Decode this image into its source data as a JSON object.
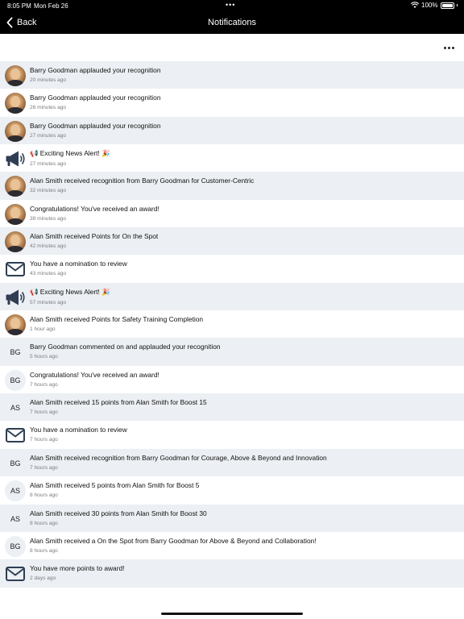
{
  "status_bar": {
    "time": "8:05 PM",
    "date": "Mon Feb 26",
    "battery": "100%"
  },
  "nav": {
    "back_label": "Back",
    "title": "Notifications"
  },
  "notifications": [
    {
      "avatar": "photo",
      "title": "Barry Goodman applauded your recognition",
      "time": "20 minutes ago"
    },
    {
      "avatar": "photo",
      "title": "Barry Goodman applauded your recognition",
      "time": "26 minutes ago"
    },
    {
      "avatar": "photo",
      "title": "Barry Goodman applauded your recognition",
      "time": "27 minutes ago"
    },
    {
      "avatar": "megaphone-icon",
      "title": "📢 Exciting News Alert! 🎉",
      "time": "27 minutes ago"
    },
    {
      "avatar": "photo",
      "title": "Alan Smith received recognition from Barry Goodman for Customer-Centric",
      "time": "32 minutes ago"
    },
    {
      "avatar": "photo",
      "title": "Congratulations! You've received an award!",
      "time": "39 minutes ago"
    },
    {
      "avatar": "photo",
      "title": "Alan Smith received Points for On the Spot",
      "time": "42 minutes ago"
    },
    {
      "avatar": "envelope-icon",
      "title": "You have a nomination to review",
      "time": "43 minutes ago"
    },
    {
      "avatar": "megaphone-icon",
      "title": "📢 Exciting News Alert! 🎉",
      "time": "57 minutes ago"
    },
    {
      "avatar": "photo",
      "title": "Alan Smith received Points for Safety Training Completion",
      "time": "1 hour ago"
    },
    {
      "avatar": "initials",
      "initials": "BG",
      "title": "Barry Goodman commented on and applauded your recognition",
      "time": "5 hours ago"
    },
    {
      "avatar": "initials",
      "initials": "BG",
      "title": "Congratulations! You've received an award!",
      "time": "7 hours ago"
    },
    {
      "avatar": "initials",
      "initials": "AS",
      "title": "Alan Smith received 15 points from Alan Smith for Boost 15",
      "time": "7 hours ago"
    },
    {
      "avatar": "envelope-icon",
      "title": "You have a nomination to review",
      "time": "7 hours ago"
    },
    {
      "avatar": "initials",
      "initials": "BG",
      "title": "Alan Smith received recognition from Barry Goodman for Courage, Above & Beyond and Innovation",
      "time": "7 hours ago"
    },
    {
      "avatar": "initials",
      "initials": "AS",
      "title": "Alan Smith received 5 points from Alan Smith for Boost 5",
      "time": "8 hours ago"
    },
    {
      "avatar": "initials",
      "initials": "AS",
      "title": "Alan Smith received 30 points from Alan Smith for Boost 30",
      "time": "8 hours ago"
    },
    {
      "avatar": "initials",
      "initials": "BG",
      "title": "Alan Smith received a On the Spot from Barry Goodman for Above & Beyond and Collaboration!",
      "time": "8 hours ago"
    },
    {
      "avatar": "envelope-icon",
      "title": "You have more points to award!",
      "time": "2 days ago"
    }
  ],
  "colors": {
    "header": "#000000",
    "row_shaded": "#eceff3",
    "row_plain": "#ffffff",
    "icon": "#2f3e52"
  }
}
